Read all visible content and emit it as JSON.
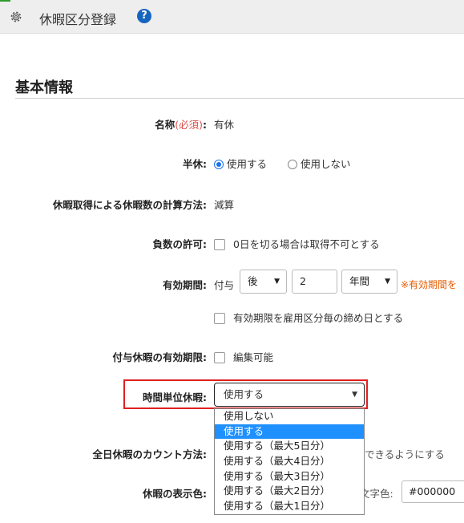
{
  "header": {
    "title": "休暇区分登録",
    "help": "?"
  },
  "section": {
    "title": "基本情報"
  },
  "form": {
    "name": {
      "label": "名称",
      "required": "(必須)",
      "colon": ":",
      "value": "有休"
    },
    "half_day": {
      "label": "半休:",
      "option_on": "使用する",
      "option_off": "使用しない",
      "selected": "使用する"
    },
    "calc_method": {
      "label": "休暇取得による休暇数の計算方法:",
      "value": "減算"
    },
    "negative": {
      "label": "負数の許可:",
      "checkbox_label": "0日を切る場合は取得不可とする",
      "checked": false
    },
    "validity": {
      "label": "有効期間:",
      "prefix": "付与",
      "direction": "後",
      "amount": "2",
      "unit": "年間",
      "note": "※有効期間を",
      "closing_checkbox_label": "有効期限を雇用区分毎の締め日とする",
      "closing_checked": false
    },
    "grant_validity": {
      "label": "付与休暇の有効期限:",
      "checkbox_label": "編集可能",
      "checked": false
    },
    "hourly": {
      "label": "時間単位休暇:",
      "selected": "使用する",
      "options": [
        "使用しない",
        "使用する",
        "使用する（最大5日分）",
        "使用する（最大4日分）",
        "使用する（最大3日分）",
        "使用する（最大2日分）",
        "使用する（最大1日分）"
      ],
      "highlighted_index": 1
    },
    "full_day_count": {
      "label": "全日休暇のカウント方法:",
      "trailing_text": "できるようにする"
    },
    "display_color": {
      "label": "休暇の表示色:",
      "text_color_label": "文字色:",
      "text_color_value": "#000000"
    }
  },
  "colors": {
    "accent": "#1e90ff",
    "required": "#d9534f",
    "note": "#e65c00",
    "highlight_border": "#e02020"
  }
}
